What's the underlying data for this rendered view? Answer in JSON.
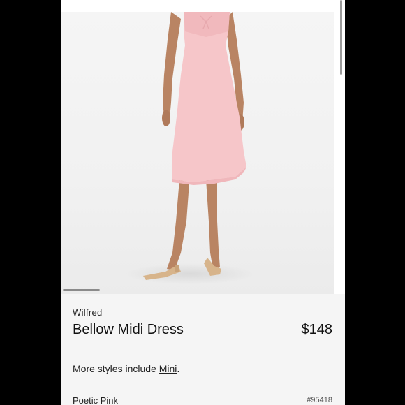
{
  "product": {
    "brand": "Wilfred",
    "name": "Bellow Midi Dress",
    "price": "$148",
    "more_styles_prefix": "More styles include ",
    "more_styles_link": "Mini",
    "more_styles_suffix": ".",
    "color_name": "Poetic Pink",
    "sku": "#95418"
  },
  "image": {
    "description_icon": "product-photo",
    "dress_color": "#f6c6c9",
    "background_color": "#f3f3f3"
  },
  "carousel": {
    "current_index": 1
  }
}
